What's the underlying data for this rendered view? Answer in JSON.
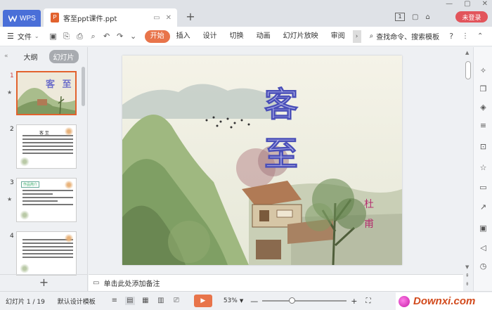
{
  "titlebar": {
    "app_tab": "WPS",
    "doc_tab": "客至ppt课件.ppt",
    "new_tab_symbol": "+",
    "login_label": "未登录",
    "page_badge": "1"
  },
  "ribbon": {
    "file_menu": "文件",
    "tabs": [
      {
        "label": "开始",
        "active": true
      },
      {
        "label": "插入"
      },
      {
        "label": "设计"
      },
      {
        "label": "切换"
      },
      {
        "label": "动画"
      },
      {
        "label": "幻灯片放映"
      },
      {
        "label": "审阅"
      }
    ],
    "search_label": "查找命令、搜索模板",
    "help_symbol": "?"
  },
  "left_panel": {
    "tabs": [
      {
        "label": "大纲"
      },
      {
        "label": "幻灯片",
        "active": true
      }
    ],
    "slides": [
      {
        "number": "1",
        "selected": true,
        "title": "客 至"
      },
      {
        "number": "2",
        "title": "客 至"
      },
      {
        "number": "3",
        "title": "作品简介"
      },
      {
        "number": "4"
      }
    ],
    "add_symbol": "+"
  },
  "slide": {
    "title": "客 至",
    "author": "杜 甫"
  },
  "notes": {
    "placeholder": "单击此处添加备注"
  },
  "statusbar": {
    "slide_counter": "幻灯片 1 / 19",
    "theme": "默认设计模板",
    "zoom": "53%",
    "zoom_level": 0.35,
    "play_symbol": "▶"
  },
  "watermark": {
    "text": "Downxi.com"
  },
  "colors": {
    "accent": "#e8744a",
    "wps_blue": "#4a6fd8",
    "login_red": "#e2545b",
    "title_fill": "#b7b8ec",
    "author": "#b4306e"
  }
}
